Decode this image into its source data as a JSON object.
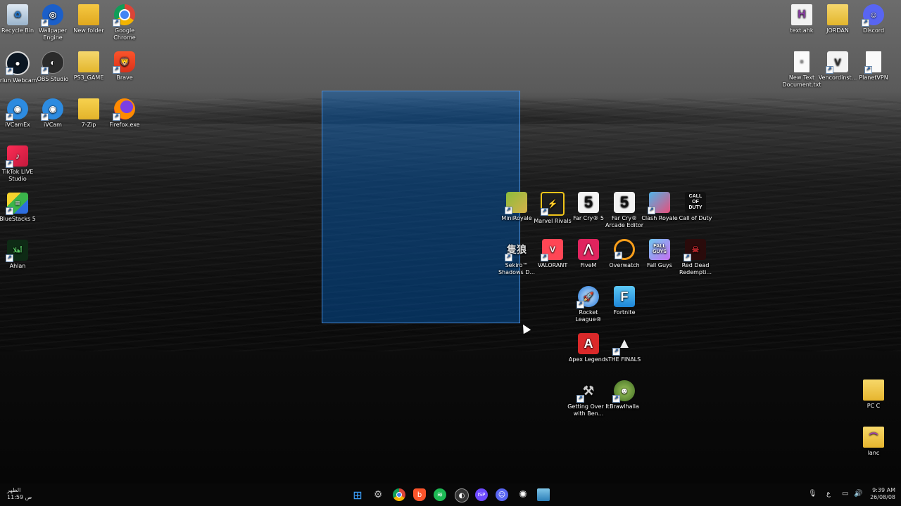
{
  "desktop": {
    "left_column_icons": [
      {
        "label": "Recycle Bin",
        "icon": "recycle-bin-icon"
      },
      {
        "label": "Wallpaper Engine",
        "icon": "wallpaper-engine-icon"
      },
      {
        "label": "New folder",
        "icon": "folder-icon"
      },
      {
        "label": "Google Chrome",
        "icon": "chrome-icon"
      },
      {
        "label": "Iriun Webcam",
        "icon": "iriun-webcam-icon"
      },
      {
        "label": "OBS Studio",
        "icon": "obs-studio-icon"
      },
      {
        "label": "PS3_GAME",
        "icon": "folder-icon"
      },
      {
        "label": "Brave",
        "icon": "brave-icon"
      },
      {
        "label": "iVCamEx",
        "icon": "ivcam-icon"
      },
      {
        "label": "iVCam",
        "icon": "ivcam-icon"
      },
      {
        "label": "7-Zip",
        "icon": "folder-icon"
      },
      {
        "label": "Firefox.exe",
        "icon": "firefox-icon"
      },
      {
        "label": "TikTok LIVE Studio",
        "icon": "tiktok-icon"
      },
      {
        "label": "BlueStacks 5",
        "icon": "bluestacks-icon"
      },
      {
        "label": "Ahlan",
        "icon": "ahlan-icon"
      }
    ],
    "right_top_icons": [
      {
        "label": "text.ahk",
        "icon": "ahk-file-icon"
      },
      {
        "label": "JORDAN",
        "icon": "folder-icon"
      },
      {
        "label": "Discord",
        "icon": "discord-icon"
      },
      {
        "label": "New Text Document.txt",
        "icon": "text-file-icon"
      },
      {
        "label": "Vencordinst...",
        "icon": "vencord-icon"
      },
      {
        "label": "PlanetVPN",
        "icon": "blank-file-icon"
      }
    ],
    "games": [
      {
        "label": "MiniRoyale",
        "icon": "miniroyale-icon"
      },
      {
        "label": "Marvel Rivals",
        "icon": "marvel-rivals-icon"
      },
      {
        "label": "Far Cry® 5",
        "icon": "far-cry-5-icon"
      },
      {
        "label": "Far Cry® Arcade Editor",
        "icon": "far-cry-5-icon"
      },
      {
        "label": "Clash Royale",
        "icon": "clash-royale-icon"
      },
      {
        "label": "Call of Duty",
        "icon": "call-of-duty-icon"
      },
      {
        "label": "Sekiro™ Shadows D...",
        "icon": "sekiro-icon"
      },
      {
        "label": "VALORANT",
        "icon": "valorant-icon"
      },
      {
        "label": "FiveM",
        "icon": "fivem-icon"
      },
      {
        "label": "Overwatch",
        "icon": "overwatch-icon"
      },
      {
        "label": "Fall Guys",
        "icon": "fall-guys-icon"
      },
      {
        "label": "Red Dead Redempti...",
        "icon": "red-dead-icon"
      },
      {
        "label": "Rocket League®",
        "icon": "rocket-league-icon"
      },
      {
        "label": "Fortnite",
        "icon": "fortnite-icon"
      },
      {
        "label": "Apex Legends",
        "icon": "apex-icon"
      },
      {
        "label": "THE FINALS",
        "icon": "the-finals-icon"
      },
      {
        "label": "Getting Over It with Ben...",
        "icon": "getting-over-it-icon"
      },
      {
        "label": "Brawlhalla",
        "icon": "brawlhalla-icon"
      }
    ],
    "right_bottom_icons": [
      {
        "label": "PC C",
        "icon": "folder-icon"
      },
      {
        "label": "lanc",
        "icon": "folder-icon"
      }
    ],
    "tile_text": {
      "call_of_duty": "CALL OF DUTY",
      "far_cry": "5",
      "fortnite": "F",
      "apex": "A",
      "text_ahk": "H",
      "fall_guys": "FALL GUYS"
    }
  },
  "taskbar": {
    "left_line1": "الظهر",
    "left_line2": "11:59 ص",
    "time": "9:39 AM",
    "date": "26/08/08",
    "language": "ع",
    "apps": [
      "windows-start-icon",
      "settings-icon",
      "chrome-icon",
      "brave-icon",
      "spotify-icon",
      "obs-studio-icon",
      "protonvpn-icon",
      "discord-icon",
      "steam-icon",
      "file-manager-icon"
    ]
  }
}
